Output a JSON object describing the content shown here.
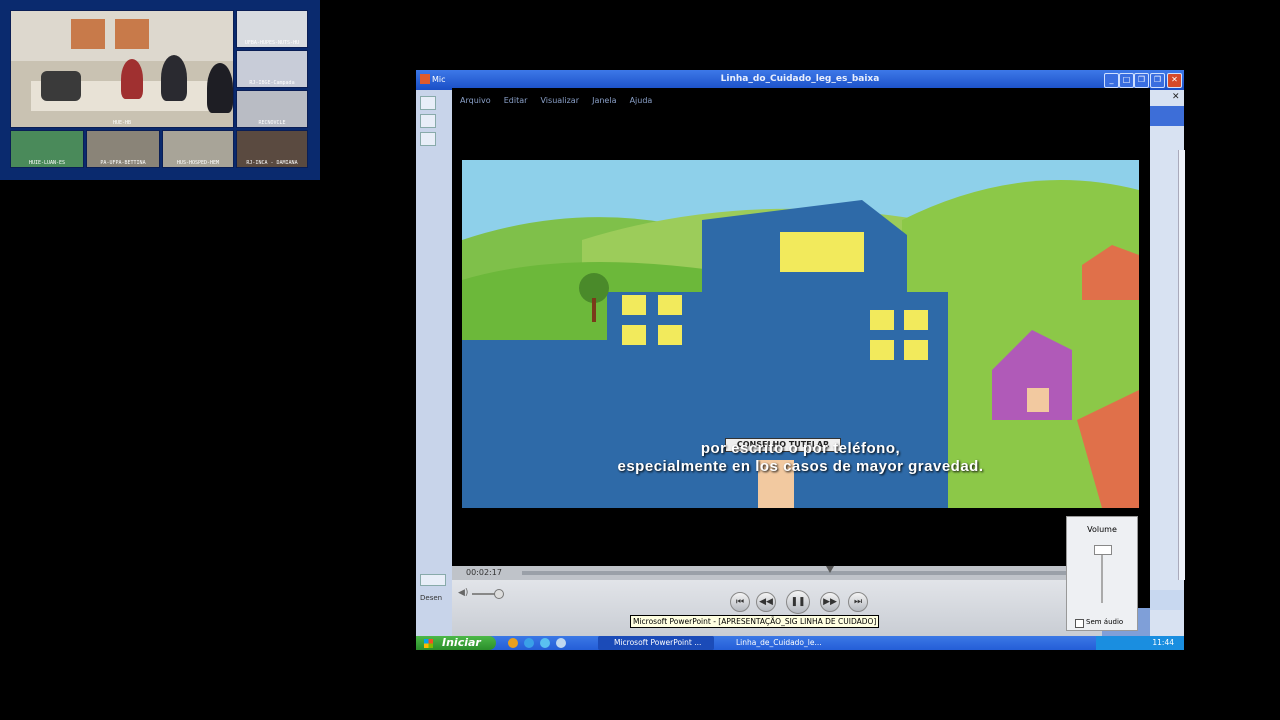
{
  "video_conference": {
    "tiles": [
      {
        "caption": "UFBA-HUPES-NUTS-HU"
      },
      {
        "caption": "RJ-IBGE-Campada"
      },
      {
        "caption": "RECNOVCLE"
      },
      {
        "caption": "HUIE-LUAN-ES"
      },
      {
        "caption": "PA-UFPA-BETTINA"
      },
      {
        "caption": "HUS-HOSPED-HEM"
      },
      {
        "caption": "RJ-INCA - DAMIANA"
      },
      {
        "caption": "HUE-HB"
      }
    ]
  },
  "window": {
    "title": "Linha_do_Cuidado_leg_es_baixa",
    "left_tab": "Mic",
    "menu": [
      "Arquivo",
      "Editar",
      "Visualizar",
      "Janela",
      "Ajuda"
    ],
    "subtitle_line1": "por escrito o por teléfono,",
    "subtitle_line2": "especialmente en los casos de mayor gravedad.",
    "sign_text": "CONSELHO TUTELAR",
    "timecode": "00:02:17",
    "volume_label": "Volume",
    "mute_label": "Sem áudio",
    "left_label": "Desen",
    "tooltip": "Microsoft PowerPoint - [APRESENTAÇÃO_SIG LINHA DE CUIDADO]"
  },
  "taskbar": {
    "start_label": "Iniciar",
    "tasks": [
      {
        "label": "Microsoft PowerPoint ..."
      },
      {
        "label": "Linha_de_Cuidado_le..."
      }
    ],
    "clock": "11:44"
  }
}
